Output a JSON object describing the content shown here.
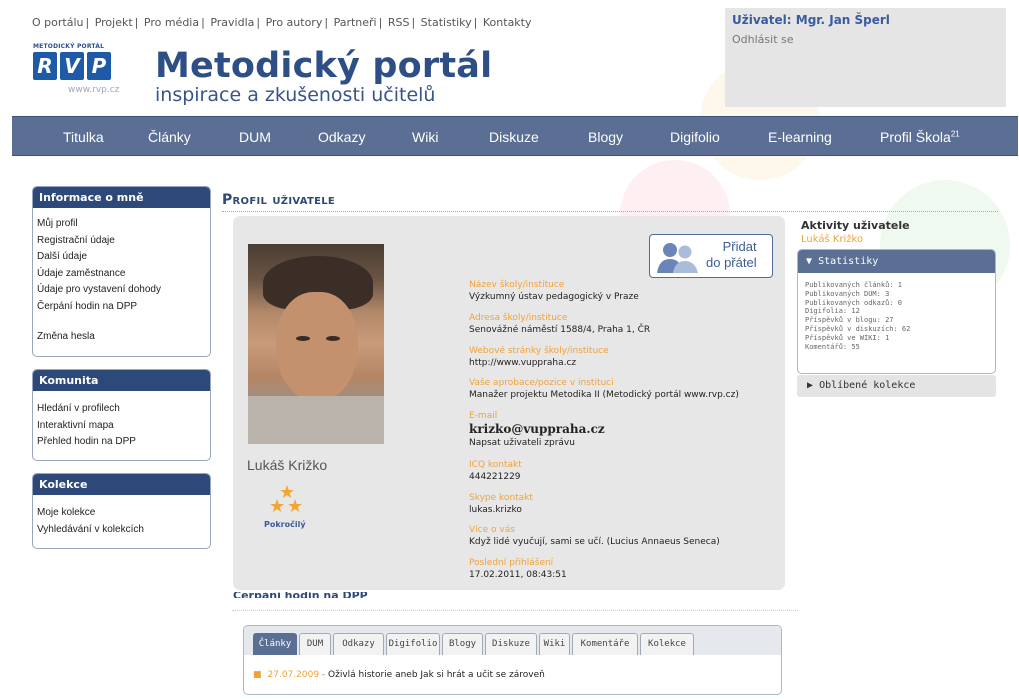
{
  "top_links": [
    "O portálu",
    "Projekt",
    "Pro média",
    "Pravidla",
    "Pro autory",
    "Partneři",
    "RSS",
    "Statistiky",
    "Kontakty"
  ],
  "user": {
    "label": "Uživatel:",
    "name": "Mgr. Jan Šperl",
    "logout": "Odhlásit se"
  },
  "logo": {
    "small": "METODICKÝ PORTÁL",
    "letters": [
      "R",
      "V",
      "P"
    ],
    "url": "www.rvp.cz",
    "title": "Metodický portál",
    "slogan": "inspirace a zkušenosti učitelů"
  },
  "nav": [
    {
      "label": "Titulka"
    },
    {
      "label": "Články"
    },
    {
      "label": "DUM"
    },
    {
      "label": "Odkazy"
    },
    {
      "label": "Wiki"
    },
    {
      "label": "Diskuze"
    },
    {
      "label": "Blogy"
    },
    {
      "label": "Digifolio"
    },
    {
      "label": "E-learning"
    },
    {
      "label": "Profil Škola",
      "sup": "21"
    }
  ],
  "sidebar": {
    "info": {
      "title": "Informace o mně",
      "items": [
        "Můj profil",
        "Registrační údaje",
        "Další údaje",
        "Údaje zaměstnance",
        "Údaje pro vystavení dohody",
        "Čerpání hodin na DPP",
        "Změna hesla"
      ]
    },
    "community": {
      "title": "Komunita",
      "items": [
        "Hledání v profilech",
        "Interaktivní mapa",
        "Přehled hodin na DPP"
      ]
    },
    "collections": {
      "title": "Kolekce",
      "items": [
        "Moje kolekce",
        "Vyhledávání v kolekcích"
      ]
    }
  },
  "profile": {
    "page_title": "Profil uživatele",
    "name": "Lukáš Križko",
    "badge": "Pokročilý",
    "add_friend": [
      "Přidat",
      "do přátel"
    ],
    "fields": [
      {
        "label": "Název školy/instituce",
        "value": "Výzkumný ústav pedagogický v Praze"
      },
      {
        "label": "Adresa školy/instituce",
        "value": "Senovážné náměstí 1588/4, Praha 1, ČR"
      },
      {
        "label": "Webové stránky školy/instituce",
        "value": "http://www.vuppraha.cz"
      },
      {
        "label": "Vaše aprobace/pozice v instituci",
        "value": "Manažer projektu Metodika II (Metodický portál www.rvp.cz)"
      },
      {
        "label": "E-mail",
        "value": "krizko@vuppraha.cz",
        "extra": "Napsat uživateli zprávu"
      },
      {
        "label": "ICQ kontakt",
        "value": "444221229"
      },
      {
        "label": "Skype kontakt",
        "value": "lukas.krizko"
      },
      {
        "label": "Více o vás",
        "value": "Když lidé vyučují, sami se učí. (Lucius Annaeus Seneca)"
      },
      {
        "label": "Poslední přihlášení",
        "value": "17.02.2011, 08:43:51"
      }
    ],
    "cut_heading": "Čerpání hodin na DPP"
  },
  "activity_tabs": {
    "tabs": [
      "Články",
      "DUM",
      "Odkazy",
      "Digifolio",
      "Blogy",
      "Diskuze",
      "Wiki",
      "Komentáře",
      "Kolekce"
    ],
    "active": "Články",
    "items": [
      {
        "date": "27.07.2009",
        "sep": " - ",
        "title": "Oživlá historie aneb Jak si hrát a učit se zároveň"
      }
    ]
  },
  "right": {
    "title": "Aktivity uživatele",
    "name": "Lukáš Križko",
    "stats_title": "Statistiky",
    "stats": [
      "Publikovaných článků: 1",
      "Publikovaných DUM: 3",
      "Publikovaných odkazů: 0",
      "Digifolia: 12",
      "Příspěvků v blogu: 27",
      "Příspěvků v diskuzích: 62",
      "Příspěvků ve WIKI: 1",
      "Komentářů: 55"
    ],
    "fav": "Oblíbené kolekce"
  },
  "colors": {
    "nav": "#5a6f93",
    "sidebar_header": "#2d4979",
    "accent_orange": "#f0a23a",
    "brand_blue": "#2e4f86"
  }
}
